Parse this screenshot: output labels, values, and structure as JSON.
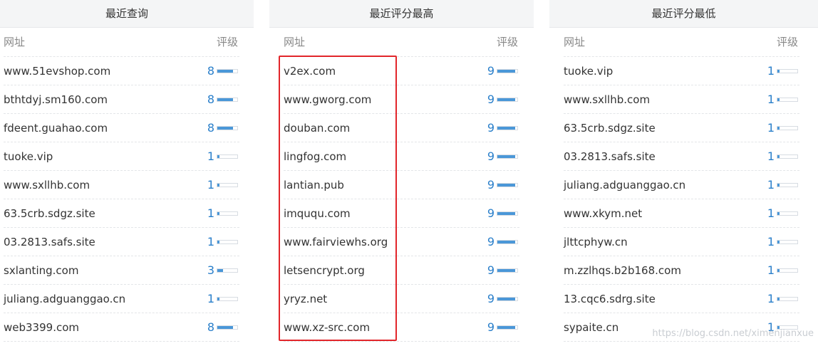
{
  "panels": [
    {
      "title": "最近查询",
      "col_site": "网址",
      "col_rating": "评级",
      "rows": [
        {
          "site": "www.51evshop.com",
          "score": 8
        },
        {
          "site": "bthtdyj.sm160.com",
          "score": 8
        },
        {
          "site": "fdeent.guahao.com",
          "score": 8
        },
        {
          "site": "tuoke.vip",
          "score": 1
        },
        {
          "site": "www.sxllhb.com",
          "score": 1
        },
        {
          "site": "63.5crb.sdgz.site",
          "score": 1
        },
        {
          "site": "03.2813.safs.site",
          "score": 1
        },
        {
          "site": "sxlanting.com",
          "score": 3
        },
        {
          "site": "juliang.adguanggao.cn",
          "score": 1
        },
        {
          "site": "web3399.com",
          "score": 8
        }
      ]
    },
    {
      "title": "最近评分最高",
      "col_site": "网址",
      "col_rating": "评级",
      "rows": [
        {
          "site": "v2ex.com",
          "score": 9
        },
        {
          "site": "www.gworg.com",
          "score": 9
        },
        {
          "site": "douban.com",
          "score": 9
        },
        {
          "site": "lingfog.com",
          "score": 9
        },
        {
          "site": "lantian.pub",
          "score": 9
        },
        {
          "site": "imququ.com",
          "score": 9
        },
        {
          "site": "www.fairviewhs.org",
          "score": 9
        },
        {
          "site": "letsencrypt.org",
          "score": 9
        },
        {
          "site": "yryz.net",
          "score": 9
        },
        {
          "site": "www.xz-src.com",
          "score": 9
        }
      ]
    },
    {
      "title": "最近评分最低",
      "col_site": "网址",
      "col_rating": "评级",
      "rows": [
        {
          "site": "tuoke.vip",
          "score": 1
        },
        {
          "site": "www.sxllhb.com",
          "score": 1
        },
        {
          "site": "63.5crb.sdgz.site",
          "score": 1
        },
        {
          "site": "03.2813.safs.site",
          "score": 1
        },
        {
          "site": "juliang.adguanggao.cn",
          "score": 1
        },
        {
          "site": "www.xkym.net",
          "score": 1
        },
        {
          "site": "jlttcphyw.cn",
          "score": 1
        },
        {
          "site": "m.zzlhqs.b2b168.com",
          "score": 1
        },
        {
          "site": "13.cqc6.sdrg.site",
          "score": 1
        },
        {
          "site": "sypaite.cn",
          "score": 1
        }
      ]
    }
  ],
  "score_max": 10,
  "watermark": "https://blog.csdn.net/ximenjianxue",
  "colors": {
    "score": "#2a7fca",
    "bar_fill": "#4a97d8",
    "highlight": "#e2262b"
  }
}
